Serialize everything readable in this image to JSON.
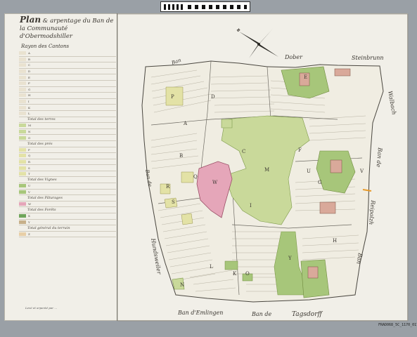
{
  "scale_bar": {},
  "legend": {
    "title_line1": "Plan",
    "title_line1_rest": "& arpentage du Ban de",
    "title_line2": "la Communauté d'Obermodshiller",
    "heading": "Rayon des Cantons",
    "rows": [
      {
        "label": "A",
        "color": "#e9e2d0"
      },
      {
        "label": "B",
        "color": "#e9e2d0"
      },
      {
        "label": "C",
        "color": "#e9e2d0"
      },
      {
        "label": "D",
        "color": "#e9e2d0"
      },
      {
        "label": "E",
        "color": "#e9e2d0"
      },
      {
        "label": "F",
        "color": "#e9e2d0"
      },
      {
        "label": "G",
        "color": "#e9e2d0"
      },
      {
        "label": "H",
        "color": "#e9e2d0"
      },
      {
        "label": "I",
        "color": "#e9e2d0"
      },
      {
        "label": "K",
        "color": "#e9e2d0"
      },
      {
        "label": "L",
        "color": "#e9e2d0"
      },
      {
        "label": "Total des terres",
        "color": "",
        "total": true
      },
      {
        "label": "M",
        "color": "#c9d99a"
      },
      {
        "label": "N",
        "color": "#c9d99a"
      },
      {
        "label": "O",
        "color": "#c9d99a"
      },
      {
        "label": "Total des prés",
        "color": "",
        "total": true
      },
      {
        "label": "P",
        "color": "#e3e2a6"
      },
      {
        "label": "Q",
        "color": "#e3e2a6"
      },
      {
        "label": "R",
        "color": "#e3e2a6"
      },
      {
        "label": "S",
        "color": "#e3e2a6"
      },
      {
        "label": "T",
        "color": "#e3e2a6"
      },
      {
        "label": "Total des Vignes",
        "color": "",
        "total": true
      },
      {
        "label": "U",
        "color": "#a7c67a"
      },
      {
        "label": "V",
        "color": "#a7c67a"
      },
      {
        "label": "Total des Pâturages",
        "color": "",
        "total": true
      },
      {
        "label": "W",
        "color": "#e5a6b9"
      },
      {
        "label": "Total des Forêts",
        "color": "",
        "total": true
      },
      {
        "label": "X",
        "color": "#6fa55a"
      },
      {
        "label": "Y",
        "color": "#c7b08a"
      },
      {
        "label": "Total général du terrain",
        "color": "",
        "total": true
      },
      {
        "label": "Z",
        "color": "#e8cfa7"
      }
    ],
    "footer": "Levé et arpenté par ..."
  },
  "map": {
    "ban_labels": {
      "north_west": "Ban",
      "north": "Dober",
      "north_east": "Steinbrunn",
      "east_1": "Walbach",
      "east_2": "Ban de",
      "east_3": "Reipolzh",
      "east_4": "Ban",
      "south_1": "Ban d'Emlingen",
      "south_2": "Ban de",
      "south_3": "Tagsdorff",
      "west_1": "Ban de",
      "west_2": "Hundsweiler"
    },
    "cantons": [
      "P",
      "D",
      "A",
      "B",
      "C",
      "W",
      "M",
      "F",
      "G",
      "U",
      "H",
      "I",
      "K",
      "O",
      "V",
      "Y",
      "L",
      "Q",
      "R",
      "S",
      "N",
      "E"
    ]
  },
  "catalog": "FRAD068_5C_1170_017"
}
